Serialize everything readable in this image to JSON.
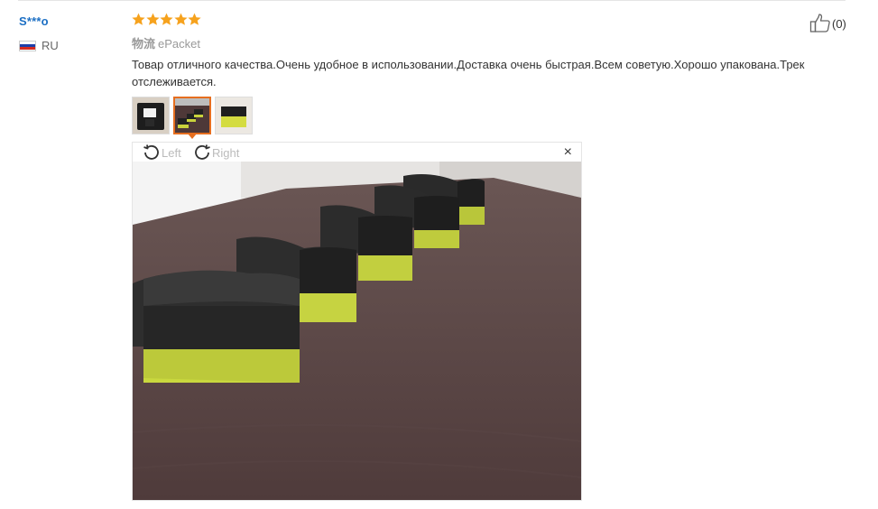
{
  "reviewer": {
    "name": "S***o",
    "country": "RU"
  },
  "rating": {
    "stars": 5,
    "max": 5
  },
  "helpful": {
    "count": "(0)"
  },
  "logistics": {
    "label": "物流",
    "value": "ePacket"
  },
  "review_text": "Товар отличного качества.Очень удобное в использовании.Доставка очень быстрая.Всем советую.Хорошо упакована.Трек отслеживается.",
  "thumbnails": [
    {
      "active": false
    },
    {
      "active": true
    },
    {
      "active": false
    }
  ],
  "viewer": {
    "rotate_left": "Left",
    "rotate_right": "Right",
    "close": "×"
  },
  "colors": {
    "accent": "#e66e1f",
    "star": "#f6a21d",
    "link": "#1c6fc4"
  }
}
